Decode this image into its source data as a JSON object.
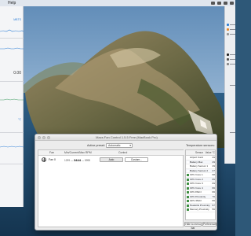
{
  "menubar": {
    "items": [
      "Help"
    ],
    "colors": {
      "background": "#eceef2"
    }
  },
  "left_panel": {
    "label_top": "MBTS",
    "value": "0.00",
    "label_unit": "°C"
  },
  "fan_window": {
    "title": "Macs Fan Control 1.5.5 Free (MacBook Pro)",
    "active_preset_label": "Active preset:",
    "active_preset_value": "Automatic",
    "temperature_sensors_label": "Temperature sensors:",
    "fan_table": {
      "columns": [
        "Fan",
        "Min/Current/Max RPM",
        "Control"
      ],
      "rows": [
        {
          "name": "Fan 0",
          "min_rpm": "1299",
          "current_rpm": "3444",
          "max_rpm": "5995",
          "auto_label": "Auto",
          "custom_label": "Custom..."
        }
      ]
    },
    "sensors_table": {
      "columns": [
        "Sensor",
        "Value °C"
      ],
      "rows": [
        {
          "name": "Airport Card",
          "value": "29"
        },
        {
          "name": "Battery Max",
          "value": "29"
        },
        {
          "name": "Battery Sensor 1",
          "value": "29"
        },
        {
          "name": "Battery Sensor 2",
          "value": "27"
        },
        {
          "name": "CPU Core 1",
          "value": "68"
        },
        {
          "name": "CPU Core 2",
          "value": "65"
        },
        {
          "name": "CPU Core 3",
          "value": "69"
        },
        {
          "name": "CPU Core 4",
          "value": "66"
        },
        {
          "name": "CPU PECI",
          "value": "66"
        },
        {
          "name": "CPU Proximity",
          "value": "76"
        },
        {
          "name": "GPU PECI",
          "value": "66"
        },
        {
          "name": "Heatsink Proximity",
          "value": "97"
        },
        {
          "name": "Memory Proximity",
          "value": "56"
        }
      ]
    },
    "hide_button": "Hide to menu bar",
    "preferences_button": "Preferences..."
  },
  "colors": {
    "sky_top": "#6b95bf",
    "sky_bottom": "#a7c3dc",
    "sea": "#1f4868",
    "island_light": "#c8b08a",
    "island_dark": "#3d4a2c",
    "sensor_green": "#3c8d3f",
    "accent_blue": "#2f7fd6"
  }
}
